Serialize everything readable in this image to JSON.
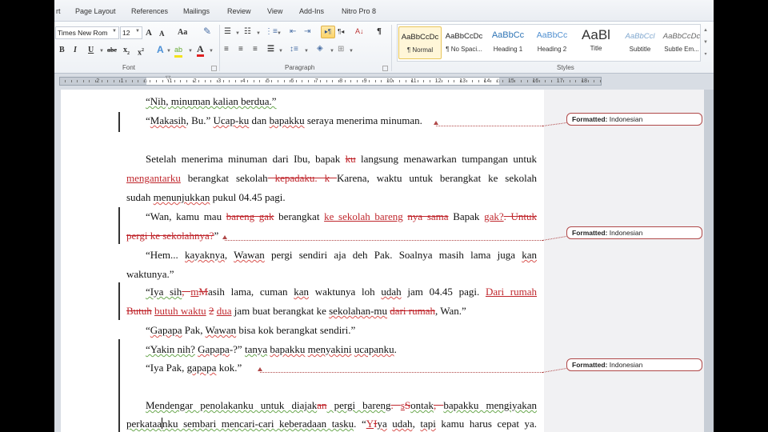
{
  "ribbon": {
    "tabs": [
      "rt",
      "Page Layout",
      "References",
      "Mailings",
      "Review",
      "View",
      "Add-Ins",
      "Nitro Pro 8"
    ],
    "font": {
      "name": "Times New Rom",
      "size": "12",
      "group_label": "Font",
      "grow_icon": "A",
      "shrink_icon": "A",
      "case_icon": "Aa",
      "bold": "B",
      "italic": "I",
      "underline": "U",
      "strike": "abe",
      "subscript": "x",
      "superscript": "x",
      "effects_icon": "A",
      "highlight_icon": "ab",
      "color_icon": "A"
    },
    "paragraph": {
      "group_label": "Paragraph",
      "pilcrow": "¶",
      "ltr": "▸¶",
      "rtl": "¶◂",
      "sort": "A↓"
    },
    "styles": {
      "group_label": "Styles",
      "items": [
        {
          "sample": "AaBbCcDc",
          "name": "¶ Normal",
          "selected": true
        },
        {
          "sample": "AaBbCcDc",
          "name": "¶ No Spaci..."
        },
        {
          "sample": "AaBbCc",
          "name": "Heading 1"
        },
        {
          "sample": "AaBbCc",
          "name": "Heading 2"
        },
        {
          "sample": "AaBl",
          "name": "Title"
        },
        {
          "sample": "AaBbCcl",
          "name": "Subtitle"
        },
        {
          "sample": "AaBbCcDc",
          "name": "Subtle Em..."
        }
      ],
      "colors": {
        "heading": "#2e74b5",
        "subtitle": "#7fa7cf",
        "title": "#333333"
      }
    }
  },
  "ruler": {
    "left_numbers": [
      "2",
      "1"
    ],
    "numbers": [
      "1",
      "2",
      "3",
      "4",
      "5",
      "6",
      "7",
      "8",
      "9",
      "10",
      "11",
      "12",
      "13",
      "14",
      "15",
      "16",
      "17",
      "18"
    ]
  },
  "document": {
    "lines": [
      {
        "parts": [
          {
            "t": "“Nih, minuman kalian berdua.”",
            "c": "sq"
          }
        ]
      },
      {
        "parts": [
          {
            "t": "“"
          },
          {
            "t": "Makasih",
            "c": "sr"
          },
          {
            "t": ", Bu.” "
          },
          {
            "t": "Ucap-ku",
            "c": "sr"
          },
          {
            "t": " dan "
          },
          {
            "t": "bapakku",
            "c": "sr"
          },
          {
            "t": " seraya menerima minuman."
          }
        ]
      },
      {
        "parts": [
          {
            "t": "Setelah menerima minuman dari Ibu, bapak "
          },
          {
            "t": "ku",
            "c": "del"
          },
          {
            "t": " langsung menawarkan tumpangan untuk"
          }
        ]
      },
      {
        "parts": [
          {
            "t": "mengantarku",
            "c": "ins"
          },
          {
            "t": " berangkat sekolah"
          },
          {
            "t": " kepadaku. k ",
            "c": "del"
          },
          {
            "t": "Karena, waktu untuk berangkat ke sekolah"
          }
        ]
      },
      {
        "parts": [
          {
            "t": "sudah "
          },
          {
            "t": "menunjukkan",
            "c": "sr"
          },
          {
            "t": " pukul 04.45 pagi."
          }
        ]
      },
      {
        "parts": [
          {
            "t": "“Wan, kamu mau "
          },
          {
            "t": "bareng gak",
            "c": "del"
          },
          {
            "t": " berangkat "
          },
          {
            "t": "ke sekolah bareng",
            "c": "ins"
          },
          {
            "t": " "
          },
          {
            "t": "nya sama",
            "c": "del"
          },
          {
            "t": " Bapak "
          },
          {
            "t": "gak?",
            "c": "ins"
          },
          {
            "t": ". Untuk",
            "c": "del"
          }
        ]
      },
      {
        "parts": [
          {
            "t": "pergi ke sekolahnya?",
            "c": "del"
          },
          {
            "t": "”"
          }
        ]
      },
      {
        "parts": [
          {
            "t": "“Hem... "
          },
          {
            "t": "kayaknya",
            "c": "sr"
          },
          {
            "t": ", "
          },
          {
            "t": "Wawan",
            "c": "sr"
          },
          {
            "t": " pergi sendiri aja deh Pak. Soalnya masih lama juga "
          },
          {
            "t": "kan",
            "c": "sr"
          }
        ]
      },
      {
        "parts": [
          {
            "t": "waktunya.”"
          }
        ]
      },
      {
        "parts": [
          {
            "t": "“Iya sih",
            "c": "sq"
          },
          {
            "t": ", ",
            "c": "del"
          },
          {
            "t": "m",
            "c": "ins"
          },
          {
            "t": "M",
            "c": "del"
          },
          {
            "t": "asih lama, cuman "
          },
          {
            "t": "kan",
            "c": "sr"
          },
          {
            "t": " waktunya loh "
          },
          {
            "t": "udah",
            "c": "sr"
          },
          {
            "t": " jam 04.45 pagi. "
          },
          {
            "t": "Dari rumah",
            "c": "ins"
          }
        ]
      },
      {
        "parts": [
          {
            "t": "Butuh",
            "c": "del"
          },
          {
            "t": " "
          },
          {
            "t": "butuh waktu",
            "c": "ins"
          },
          {
            "t": " "
          },
          {
            "t": "2",
            "c": "del"
          },
          {
            "t": " "
          },
          {
            "t": "dua",
            "c": "ins"
          },
          {
            "t": " jam buat berangkat ke "
          },
          {
            "t": "sekolahan-mu",
            "c": "sr"
          },
          {
            "t": " "
          },
          {
            "t": "dari rumah",
            "c": "del"
          },
          {
            "t": ", Wan.”"
          }
        ]
      },
      {
        "parts": [
          {
            "t": "“"
          },
          {
            "t": "Gapapa",
            "c": "sr"
          },
          {
            "t": " Pak, "
          },
          {
            "t": "Wawan",
            "c": "sr"
          },
          {
            "t": " bisa kok berangkat sendiri.”"
          }
        ]
      },
      {
        "parts": [
          {
            "t": "“Yakin nih?",
            "c": "sq"
          },
          {
            "t": " "
          },
          {
            "t": "Gapapa",
            "c": "sr"
          },
          {
            "t": "-?” "
          },
          {
            "t": "tanya",
            "c": "sq"
          },
          {
            "t": " "
          },
          {
            "t": "bapakku",
            "c": "sr"
          },
          {
            "t": " "
          },
          {
            "t": "menyakini",
            "c": "sr"
          },
          {
            "t": " "
          },
          {
            "t": "ucapanku",
            "c": "sr"
          },
          {
            "t": "."
          }
        ]
      },
      {
        "parts": [
          {
            "t": "“Iya Pak, "
          },
          {
            "t": "gapapa",
            "c": "sr"
          },
          {
            "t": " kok.”"
          }
        ]
      },
      {
        "parts": [
          {
            "t": "Mendengar penolakanku untuk diajak",
            "c": "sq"
          },
          {
            "t": "an",
            "c": "del"
          },
          {
            "t": " pergi bareng",
            "c": "sq"
          },
          {
            "t": ". ",
            "c": "del"
          },
          {
            "t": "s",
            "c": "ins"
          },
          {
            "t": "S",
            "c": "del"
          },
          {
            "t": "ontak",
            "c": "sq"
          },
          {
            "t": ", ",
            "c": "del"
          },
          {
            "t": "bapakku mengiyakan",
            "c": "sq"
          }
        ]
      },
      {
        "parts": [
          {
            "t": "perkataa",
            "c": "sq"
          },
          {
            "t": "CARET"
          },
          {
            "t": "nku sembari mencari-cari keberadaan tasku",
            "c": "sq"
          },
          {
            "t": ". “"
          },
          {
            "t": "Y",
            "c": "ins"
          },
          {
            "t": "I",
            "c": "del"
          },
          {
            "t": "ya",
            "c": "sr"
          },
          {
            "t": " "
          },
          {
            "t": "udah",
            "c": "sr"
          },
          {
            "t": ", "
          },
          {
            "t": "tapi",
            "c": "sr"
          },
          {
            "t": " kamu harus cepat ya."
          }
        ]
      }
    ]
  },
  "markup": {
    "balloons": [
      {
        "label": "Formatted:",
        "value": "Indonesian"
      },
      {
        "label": "Formatted:",
        "value": "Indonesian"
      },
      {
        "label": "Formatted:",
        "value": "Indonesian"
      }
    ],
    "color": "#b04848"
  }
}
